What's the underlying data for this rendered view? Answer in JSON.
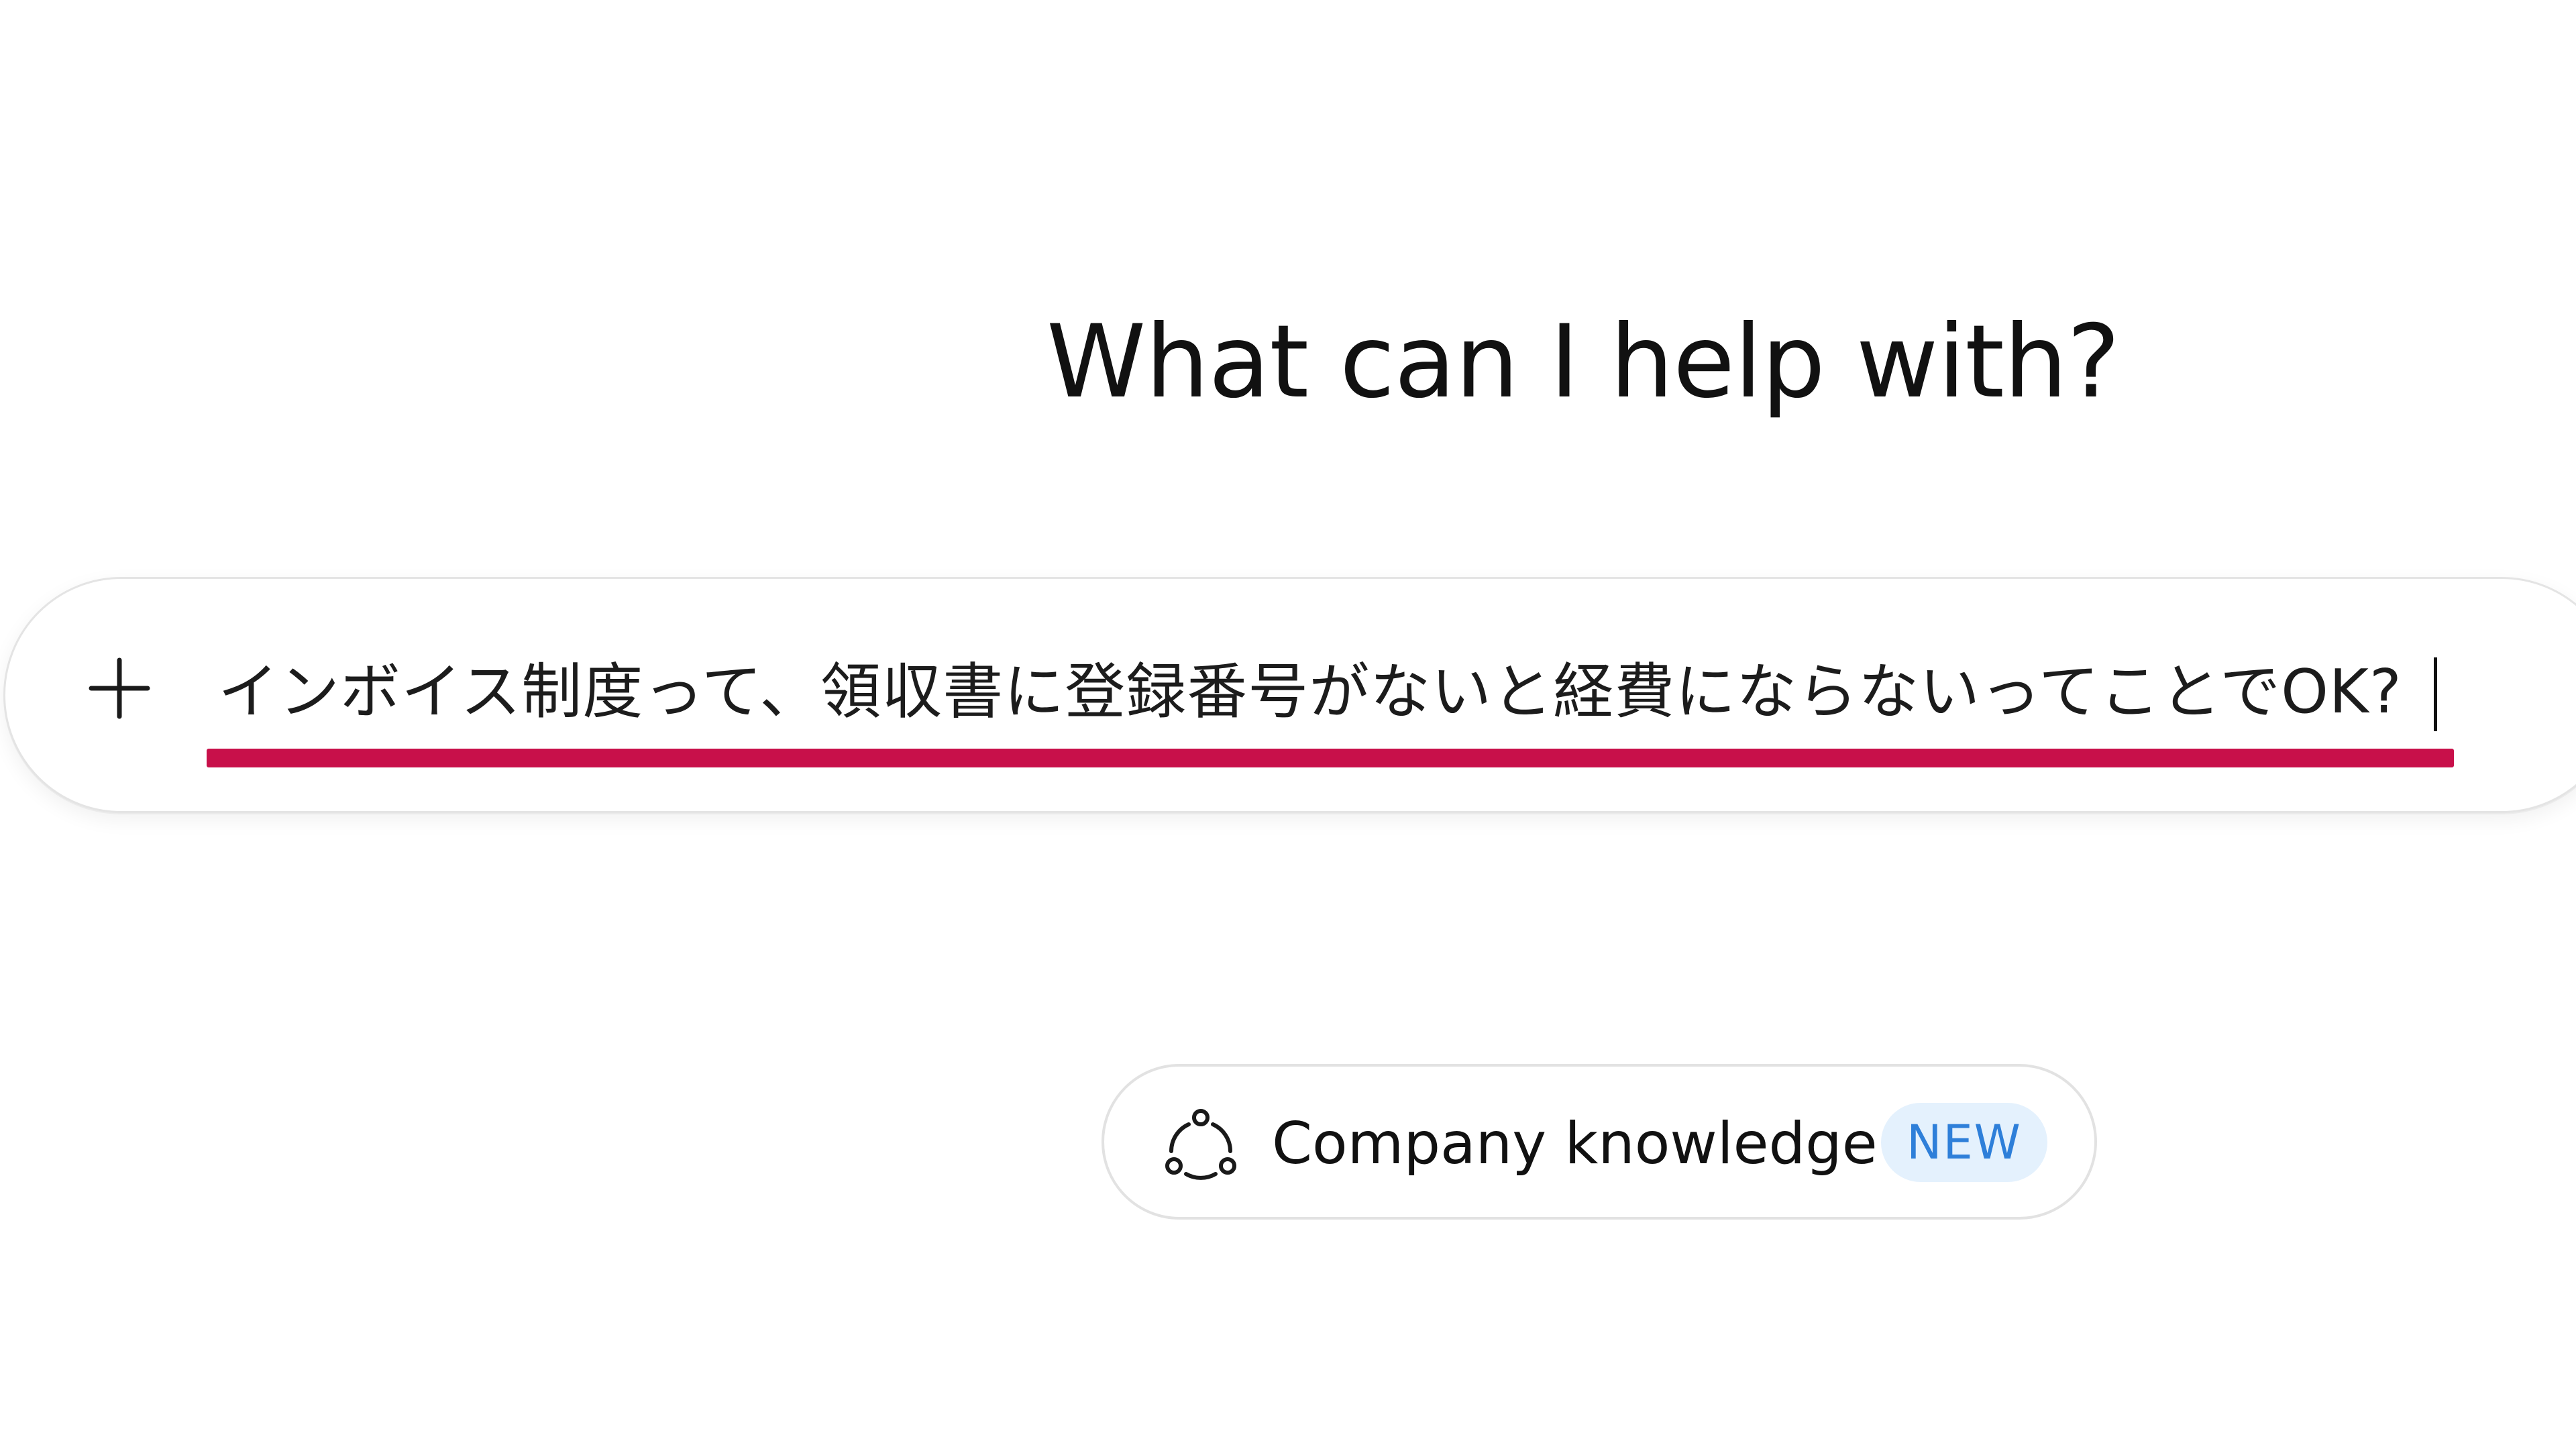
{
  "header": {
    "title": "What can I help with?"
  },
  "composer": {
    "add_icon": "plus-icon",
    "input_value": "インボイス制度って、領収書に登録番号がないと経費にならないってことでOK?",
    "highlight_color": "#c8104a"
  },
  "chips": {
    "company_knowledge": {
      "icon": "connections-icon",
      "label": "Company knowledge",
      "badge": "NEW",
      "badge_color": "#2e7fd9"
    }
  }
}
